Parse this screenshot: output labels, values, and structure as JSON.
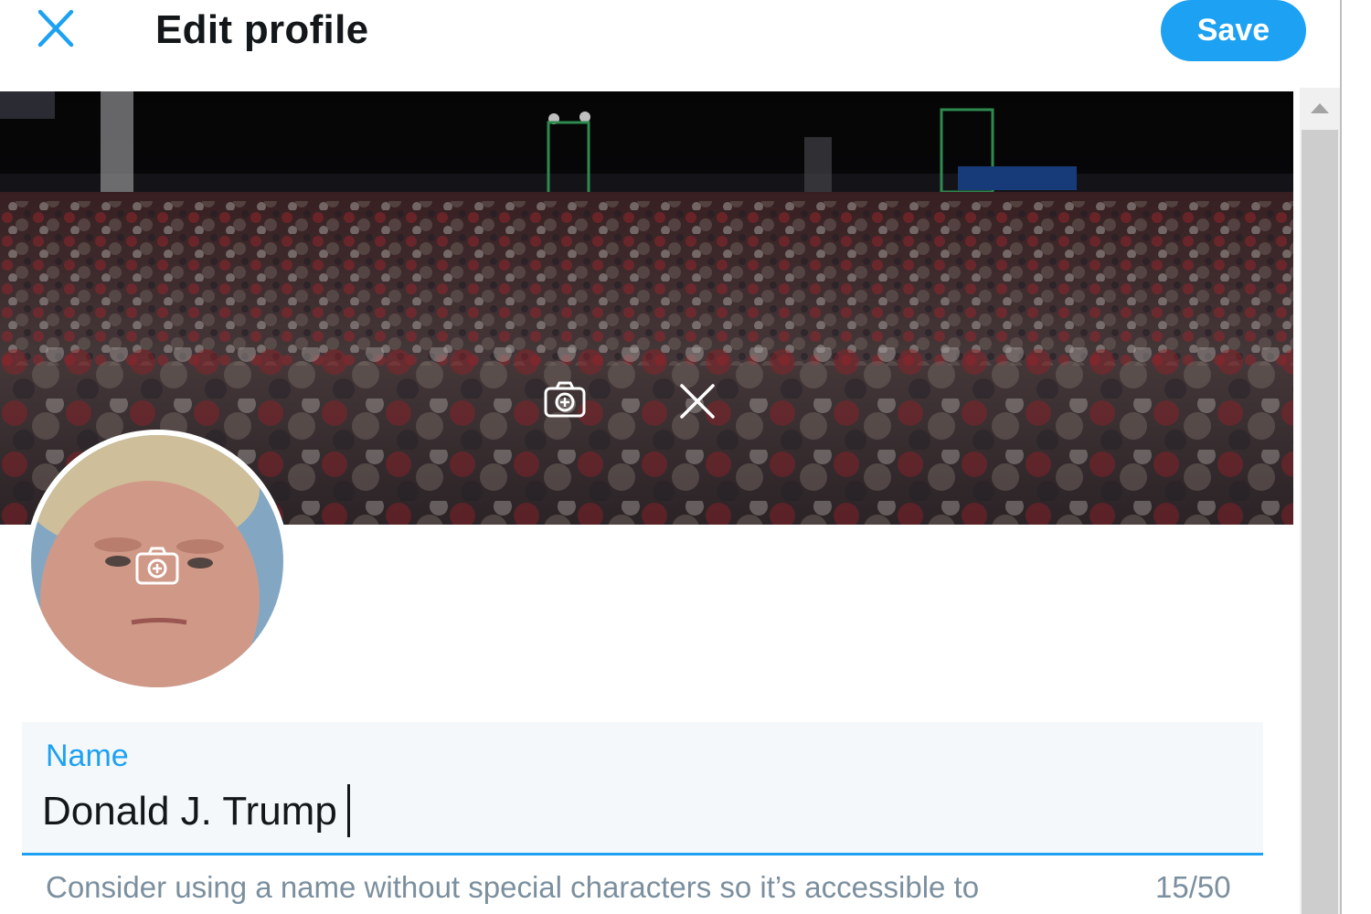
{
  "header": {
    "title": "Edit profile",
    "close_icon": "close-icon",
    "save_label": "Save"
  },
  "banner": {
    "change_photo_icon": "camera-add-icon",
    "remove_photo_icon": "close-icon"
  },
  "avatar": {
    "change_photo_icon": "camera-add-icon"
  },
  "name_field": {
    "label": "Name",
    "value": "Donald J. Trump",
    "hint": "Consider using a name without special characters so it’s accessible to",
    "counter": "15/50"
  },
  "colors": {
    "accent": "#1da1f2",
    "title_text": "#14171a",
    "hint_text": "#7b8f9e",
    "field_bg": "#f5f8fa"
  }
}
